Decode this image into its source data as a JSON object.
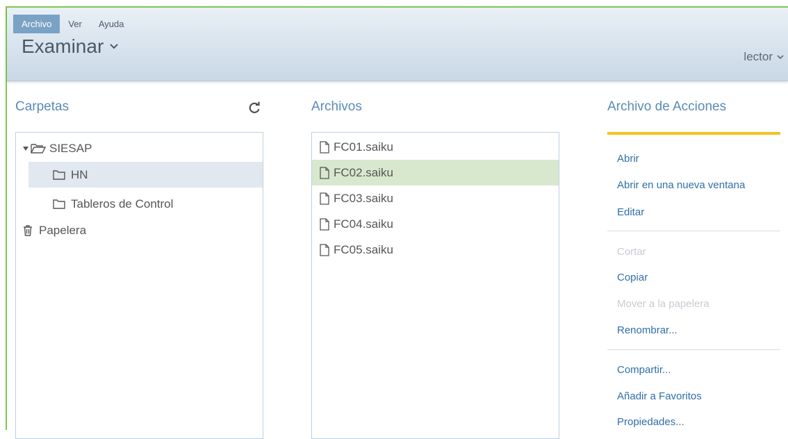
{
  "menu": {
    "items": [
      {
        "label": "Archivo",
        "active": true
      },
      {
        "label": "Ver",
        "active": false
      },
      {
        "label": "Ayuda",
        "active": false
      }
    ]
  },
  "header": {
    "perspective_label": "Examinar",
    "user_label": "lector"
  },
  "folders": {
    "title": "Carpetas",
    "items": [
      {
        "label": "SIESAP",
        "expanded": true
      },
      {
        "label": "HN",
        "selected": true
      },
      {
        "label": "Tableros de Control"
      },
      {
        "label": "Papelera"
      }
    ]
  },
  "files": {
    "title": "Archivos",
    "items": [
      {
        "label": "FC01.saiku"
      },
      {
        "label": "FC02.saiku",
        "selected": true
      },
      {
        "label": "FC03.saiku"
      },
      {
        "label": "FC04.saiku"
      },
      {
        "label": "FC05.saiku"
      }
    ]
  },
  "actions": {
    "title": "Archivo de Acciones",
    "items": [
      {
        "label": "Abrir",
        "enabled": true
      },
      {
        "label": "Abrir en una nueva ventana",
        "enabled": true
      },
      {
        "label": "Editar",
        "enabled": true
      },
      {
        "label": "Cortar",
        "enabled": false
      },
      {
        "label": "Copiar",
        "enabled": true
      },
      {
        "label": "Mover a la papelera",
        "enabled": false
      },
      {
        "label": "Renombrar...",
        "enabled": true
      },
      {
        "label": "Compartir...",
        "enabled": true
      },
      {
        "label": "Añadir a Favoritos",
        "enabled": true
      },
      {
        "label": "Propiedades...",
        "enabled": true
      }
    ]
  },
  "colors": {
    "accent": "#5b8ab6",
    "menu_active": "#7aa2c4",
    "selection_file": "#d8e8cf",
    "selection_folder": "#e1e8ef",
    "action_link": "#2f6fa8",
    "tab_highlight": "#f2c31b"
  }
}
